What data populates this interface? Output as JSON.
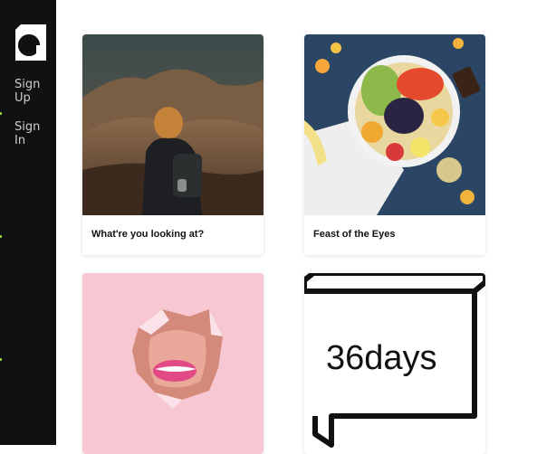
{
  "sidebar": {
    "nav": [
      {
        "label_line1": "Sign",
        "label_line2": "Up"
      },
      {
        "label_line1": "Sign",
        "label_line2": "In"
      }
    ],
    "accent_color": "#8cc63f"
  },
  "cards": [
    {
      "title": "What're you looking at?"
    },
    {
      "title": "Feast of the Eyes"
    },
    {
      "title": ""
    },
    {
      "title": "",
      "art_text": "36days"
    }
  ]
}
